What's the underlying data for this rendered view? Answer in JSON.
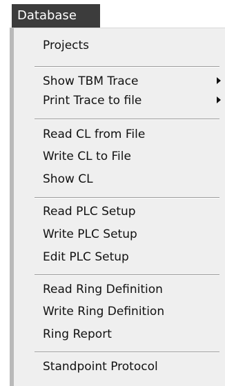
{
  "menu": {
    "title": "Database",
    "groups": [
      {
        "items": [
          {
            "label": "Projects"
          }
        ]
      },
      {
        "items": [
          {
            "label": "Show TBM Trace"
          },
          {
            "label": "Print Trace to file"
          }
        ]
      },
      {
        "items": [
          {
            "label": "Read CL from File"
          },
          {
            "label": "Write CL to File"
          },
          {
            "label": "Show CL"
          }
        ]
      },
      {
        "items": [
          {
            "label": "Read PLC Setup"
          },
          {
            "label": "Write PLC Setup"
          },
          {
            "label": "Edit PLC Setup"
          }
        ]
      },
      {
        "items": [
          {
            "label": "Read Ring Definition"
          },
          {
            "label": "Write Ring Definition"
          },
          {
            "label": "Ring Report"
          }
        ]
      },
      {
        "items": [
          {
            "label": "Standpoint Protocol"
          }
        ]
      }
    ],
    "submenu_indicators": [
      "submenu-arrow-icon",
      "submenu-arrow-icon"
    ]
  }
}
